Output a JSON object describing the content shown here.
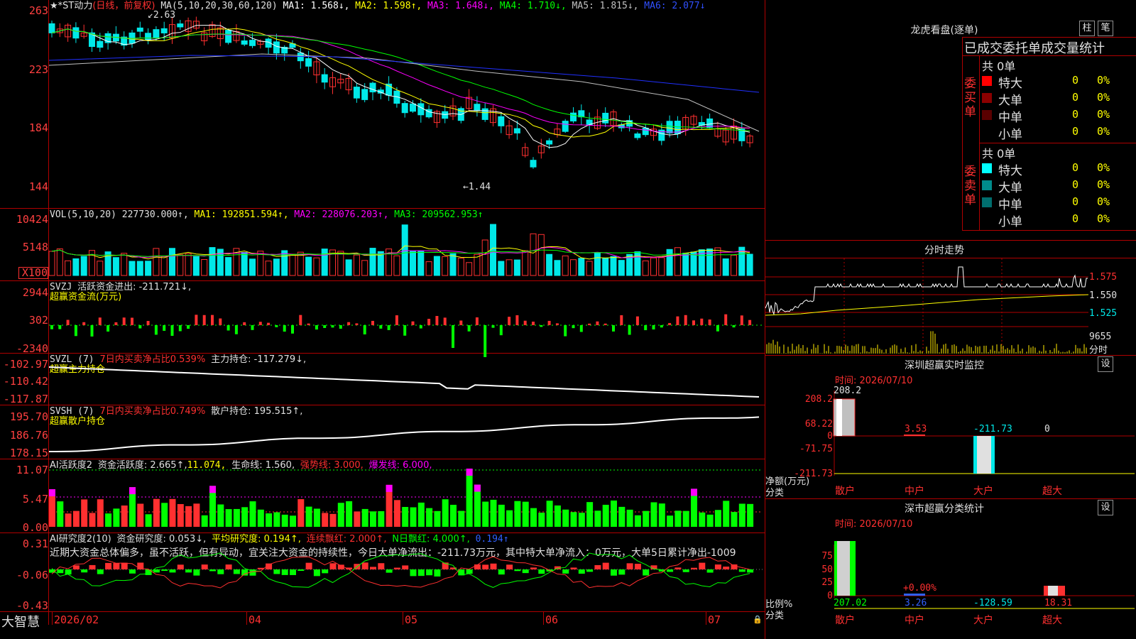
{
  "main_header": {
    "stock": "★*ST动力",
    "period": "(日线，前复权)",
    "ma_label": "MA(5,10,20,30,60,120)",
    "ma1": "MA1: 1.568↓,",
    "ma2": "MA2: 1.598↑,",
    "ma3": "MA3: 1.648↓,",
    "ma4": "MA4: 1.710↓,",
    "ma5": "MA5: 1.815↓,",
    "ma6": "MA6: 2.077↓",
    "high_mark": "2.63",
    "low_mark": "1.44"
  },
  "price_axis": [
    "263",
    "223",
    "184",
    "144"
  ],
  "vol_header": {
    "label": "VOL(5,10,20)",
    "value": "227730.000↑,",
    "ma1": "MA1: 192851.594↑,",
    "ma2": "MA2: 228076.203↑,",
    "ma3": "MA3: 209562.953↑"
  },
  "vol_axis": [
    "10424",
    "5148",
    "X100"
  ],
  "svzj": {
    "label": "SVZJ",
    "value": "活跃资金进出: -211.721↓,",
    "sub": "超赢资金流(万元)",
    "axis": [
      "2944",
      "302",
      "-2340"
    ]
  },
  "svzl": {
    "label": "SVZL (7)",
    "ratio": "7日内买卖净占比0.539%",
    "holding": "主力持仓: -117.279↓,",
    "sub": "超赢主力持仓",
    "axis": [
      "-102.97",
      "-110.42",
      "-117.87"
    ]
  },
  "svsh": {
    "label": "SVSH (7)",
    "ratio": "7日内买卖净占比0.749%",
    "holding": "散户持仓: 195.515↑,",
    "sub": "超赢散户持仓",
    "axis": [
      "195.70",
      "186.76",
      "178.15"
    ]
  },
  "ai_active": {
    "label": "AI活跃度2",
    "activity": "资金活跃度: 2.665↑,",
    "v2": "11.074,",
    "life": "生命线: 1.560,",
    "strong": "强势线: 3.000,",
    "burst": "爆发线: 6.000,",
    "axis": [
      "11.07",
      "5.47",
      "0.00"
    ]
  },
  "ai_research": {
    "label": "AI研究度2(10)",
    "research": "资金研究度: 0.053↓,",
    "avg": "平均研究度: 0.194↑,",
    "consec": "连续飘红: 2.000↑,",
    "n_days": "N日飘红: 4.000↑,",
    "last": "0.194↑",
    "comment": "近期大资金总体偏多，虽不活跃，但有异动，宜关注大资金的持续性，今日大单净流出：-211.73万元，其中特大单净流入：0万元，大单5日累计净出-1009",
    "axis": [
      "0.31",
      "-0.06",
      "-0.43"
    ]
  },
  "footer": {
    "brand": "大智慧",
    "dates": [
      "2026/02",
      "04",
      "05",
      "06",
      "07"
    ]
  },
  "dragon": {
    "title": "龙虎看盘(逐单)",
    "btn1": "柱",
    "btn2": "笔",
    "tabs": "已成交委托单成交量统计",
    "buy_side": "委买单",
    "sell_side": "委卖单",
    "buy_total": "共 0单",
    "sell_total": "共 0单",
    "buy_rows": [
      {
        "label": "特大",
        "count": "0",
        "pct": "0%",
        "color": "#ff0000"
      },
      {
        "label": "大单",
        "count": "0",
        "pct": "0%",
        "color": "#8b0000"
      },
      {
        "label": "中单",
        "count": "0",
        "pct": "0%",
        "color": "#5a0000"
      },
      {
        "label": "小单",
        "count": "0",
        "pct": "0%",
        "color": "#000000"
      }
    ],
    "sell_rows": [
      {
        "label": "特大",
        "count": "0",
        "pct": "0%",
        "color": "#00ffff"
      },
      {
        "label": "大单",
        "count": "0",
        "pct": "0%",
        "color": "#008b8b"
      },
      {
        "label": "中单",
        "count": "0",
        "pct": "0%",
        "color": "#006e6e"
      },
      {
        "label": "小单",
        "count": "0",
        "pct": "0%",
        "color": "#000000"
      }
    ]
  },
  "intraday": {
    "title": "分时走势",
    "axis": [
      "1.575",
      "1.550",
      "1.525"
    ],
    "vol_label": "9655",
    "time_label": "分时"
  },
  "monitor": {
    "title": "深圳超赢实时监控",
    "btn": "设",
    "time": "时间: 2026/07/10",
    "axis": [
      "208.2",
      "68.22",
      "0",
      "-71.75",
      "-211.73"
    ],
    "values": [
      "208.2",
      "3.53",
      "-211.73",
      "0"
    ],
    "cats": [
      "散户",
      "中户",
      "大户",
      "超大"
    ],
    "net_label": "净额(万元)",
    "cat_label": "分类"
  },
  "classify": {
    "title": "深市超赢分类统计",
    "btn": "设",
    "time": "时间: 2026/07/10",
    "axis": [
      "75",
      "50",
      "25",
      "0"
    ],
    "pct_label": "比例%",
    "cat_label": "分类",
    "mid_label": "+0.00%",
    "values": [
      "207.02",
      "3.26",
      "-128.59",
      "18.31"
    ],
    "cats": [
      "散户",
      "中户",
      "大户",
      "超大"
    ]
  },
  "colors": {
    "up": "#ff3030",
    "down": "#00e8e8",
    "grid": "#b00000",
    "ma1": "#ffffff",
    "ma2": "#ffff00",
    "ma3": "#ff00ff",
    "ma4": "#00ff00",
    "ma5": "#c0c0c0",
    "ma6": "#0000ff"
  }
}
